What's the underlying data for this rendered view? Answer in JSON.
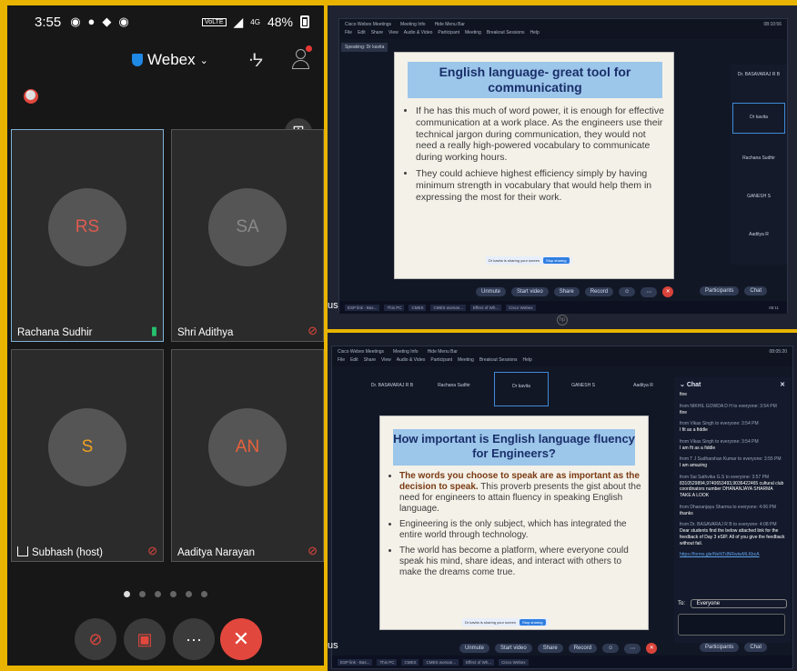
{
  "phone": {
    "status": {
      "time": "3:55",
      "battery": "48%",
      "network": "4G",
      "volte": "VoLTE"
    },
    "app_name": "Webex",
    "tiles": [
      {
        "initials": "RS",
        "name": "Rachana Sudhir",
        "mic": "on",
        "initials_color": "#e05a4e"
      },
      {
        "initials": "SA",
        "name": "Shri Adithya",
        "mic": "muted",
        "initials_color": "#8a8a8a"
      },
      {
        "initials": "S",
        "name": "Subhash  (host)",
        "mic": "muted",
        "initials_color": "#f0a020"
      },
      {
        "initials": "AN",
        "name": "Aaditya Narayan",
        "mic": "muted",
        "initials_color": "#e8613a"
      }
    ],
    "page_count": 6,
    "current_page": 1,
    "controls": {
      "more": "···"
    }
  },
  "top_shot": {
    "window_title": "Cisco Webex Meetings",
    "meeting_info": "Meeting Info",
    "hide_menu": "Hide Menu Bar",
    "time": "08:10:56",
    "menu": [
      "File",
      "Edit",
      "Share",
      "View",
      "Audio & Video",
      "Participant",
      "Meeting",
      "Breakout Sessions",
      "Help"
    ],
    "speaking": "Speaking: Dr kavita",
    "slide_title": "English language- great tool for communicating",
    "bullets": [
      "If he has this much of word power, it is enough for effective communication at a work place. As the engineers use their technical jargon during communication, they would not need a really high-powered vocabulary to communicate during working hours.",
      "They could achieve highest efficiency simply by having minimum strength in vocabulary that would help them in expressing the most for their work."
    ],
    "participants": [
      "Dr. BASAVARAJ R B",
      "Dr kavita",
      "Rachana Sudhir",
      "GANESH S",
      "Aaditya R"
    ],
    "share_strip": {
      "text": "Dr kavita is sharing your screen",
      "stop": "Stop sharing"
    },
    "toolbar": {
      "unmute": "Unmute",
      "video": "Start video",
      "share": "Share",
      "record": "Record",
      "participants": "Participants",
      "chat": "Chat"
    },
    "taskbar": [
      "ESP link - Bas...",
      "This PC",
      "CMES",
      "CMES woman...",
      "Effect of Wh...",
      "Cisco Webex"
    ],
    "clock": "08:11",
    "us_label": "us"
  },
  "bottom_shot": {
    "window_title": "Cisco Webex Meetings",
    "meeting_info": "Meeting Info",
    "hide_menu": "Hide Menu Bar",
    "time": "08:05:20",
    "menu": [
      "File",
      "Edit",
      "Share",
      "View",
      "Audio & Video",
      "Participant",
      "Meeting",
      "Breakout Sessions",
      "Help"
    ],
    "participants": [
      "Dr. BASAVARAJ R B",
      "Rachana Sudhir",
      "Dr kavita",
      "GANESH S",
      "Aaditya R"
    ],
    "slide_title": "How important is English language fluency for Engineers?",
    "bullets": [
      {
        "highlight": "The words you choose to speak are as important as the decision to speak.",
        "text": " This proverb presents the gist about the need for engineers to attain fluency in speaking English language."
      },
      {
        "highlight": "",
        "text": "Engineering is the only subject, which has integrated the entire world through technology."
      },
      {
        "highlight": "",
        "text": "The world has become a platform, where everyone could speak his mind, share ideas, and interact with others to make the dreams come true."
      }
    ],
    "share_strip": {
      "text": "Dr kavita is sharing your screen",
      "stop": "Stop sharing"
    },
    "chat": {
      "title": "Chat",
      "messages": [
        {
          "from": "",
          "text": "fine"
        },
        {
          "from": "from NIKHIL GOWDA D H to everyone:   3:54 PM",
          "text": "fine"
        },
        {
          "from": "from Vikas Singh to everyone:   3:54 PM",
          "text": "I fit as a fiddle"
        },
        {
          "from": "from Vikas Singh to everyone:   3:54 PM",
          "text": "I am fit as a fiddle"
        },
        {
          "from": "from T J Sudharshan Kumar to everyone:   3:55 PM",
          "text": "I am amazing"
        },
        {
          "from": "from Sai Sathvika G.S to everyone:   3:57 PM",
          "text": "8310529894,9740653493,9036422465 cultural club coordinators number DHANANJAYA SHARMA TAKE A LOOK"
        },
        {
          "from": "from Dhananjaya Sharma to everyone:   4:06 PM",
          "text": "thanks"
        },
        {
          "from": "from Dr. BASAVARAJ R B to everyone:   4:08 PM",
          "text": "Dear students find the below attached link for the feedback of Day 3  eSIP. All of you give the feedback without fail."
        },
        {
          "from": "",
          "text": "https://forms.gle/NeNTdNRwtwMLKbcA",
          "link": true
        }
      ],
      "to_label": "To:",
      "to_value": "Everyone"
    },
    "toolbar": {
      "unmute": "Unmute",
      "video": "Start video",
      "share": "Share",
      "record": "Record",
      "participants": "Participants",
      "chat": "Chat"
    },
    "taskbar": [
      "ESP link - Bas...",
      "This PC",
      "CMES",
      "CMES woman...",
      "Effect of Wh...",
      "Cisco Webex"
    ],
    "us_label": "us"
  }
}
